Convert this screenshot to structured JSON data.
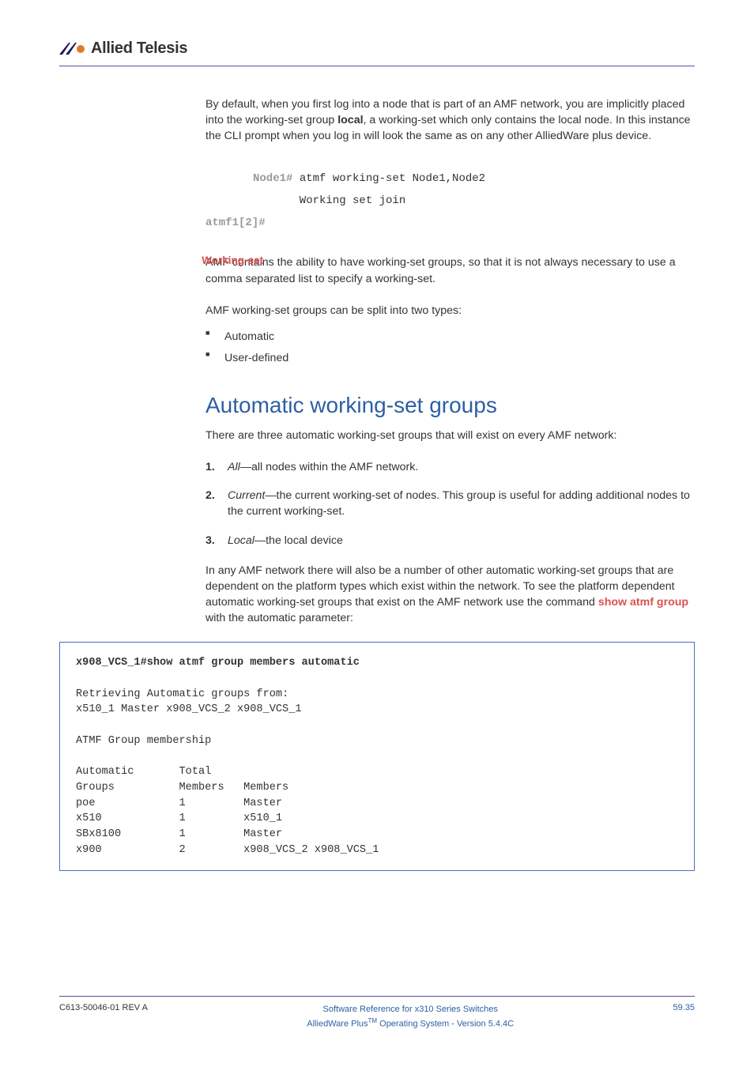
{
  "header": {
    "brand": "Allied Telesis"
  },
  "intro_para": "By default, when you first log into a node that is part of an AMF network, you are implicitly placed into the working-set group ",
  "intro_bold": "local",
  "intro_para2": ", a working-set which only contains the local node. In this instance the CLI prompt when you log in will look the same as on any other AlliedWare plus device.",
  "code1_prompt": "Node1#",
  "code1_cmd": " atmf working-set Node1,Node2",
  "code1_line2": "       Working set join",
  "code1_prompt2": "atmf1[2]#",
  "side_label": "Working-set",
  "ws_para1": "AMF contains the ability to have working-set groups, so that it is not always necessary to use a comma separated list to specify a working-set.",
  "ws_para2": "AMF working-set groups can be split into two types:",
  "bullets": [
    "Automatic",
    "User-defined"
  ],
  "section_title": "Automatic working-set groups",
  "section_intro": "There are three automatic working-set groups that will exist on every AMF network:",
  "list": [
    {
      "term": "All",
      "rest": "—all nodes within the AMF network."
    },
    {
      "term": "Current",
      "rest": "—the current working-set of nodes. This group is useful for adding additional nodes to the current working-set."
    },
    {
      "term": "Local",
      "rest": "—the local device"
    }
  ],
  "para_after_list1": "In any AMF network there will also be a number of other automatic working-set groups that are dependent on the platform types which exist within the network. To see the platform dependent automatic working-set groups that exist on the AMF network use the command ",
  "link_text": "show atmf group",
  "para_after_list2": " with the automatic parameter:",
  "output": {
    "cmd_prompt": "x908_VCS_1#",
    "cmd": "show atmf group members automatic",
    "line_retrieving": "Retrieving Automatic groups from:",
    "line_nodes": "x510_1 Master x908_VCS_2 x908_VCS_1",
    "line_membership": "ATMF Group membership",
    "hdr_c1": "Automatic",
    "hdr_c2": "Total",
    "hdr2_c1": "Groups",
    "hdr2_c2": "Members",
    "hdr2_c3": "Members",
    "rows": [
      {
        "c1": "poe",
        "c2": "1",
        "c3": "Master"
      },
      {
        "c1": "x510",
        "c2": "1",
        "c3": "x510_1"
      },
      {
        "c1": "SBx8100",
        "c2": "1",
        "c3": "Master"
      },
      {
        "c1": "x900",
        "c2": "2",
        "c3": "x908_VCS_2 x908_VCS_1"
      }
    ]
  },
  "footer": {
    "left": "C613-50046-01 REV A",
    "center_line1": "Software Reference for x310 Series Switches",
    "center_line2a": "AlliedWare Plus",
    "center_line2b": " Operating System - Version 5.4.4C",
    "tm": "TM",
    "right": "59.35"
  }
}
